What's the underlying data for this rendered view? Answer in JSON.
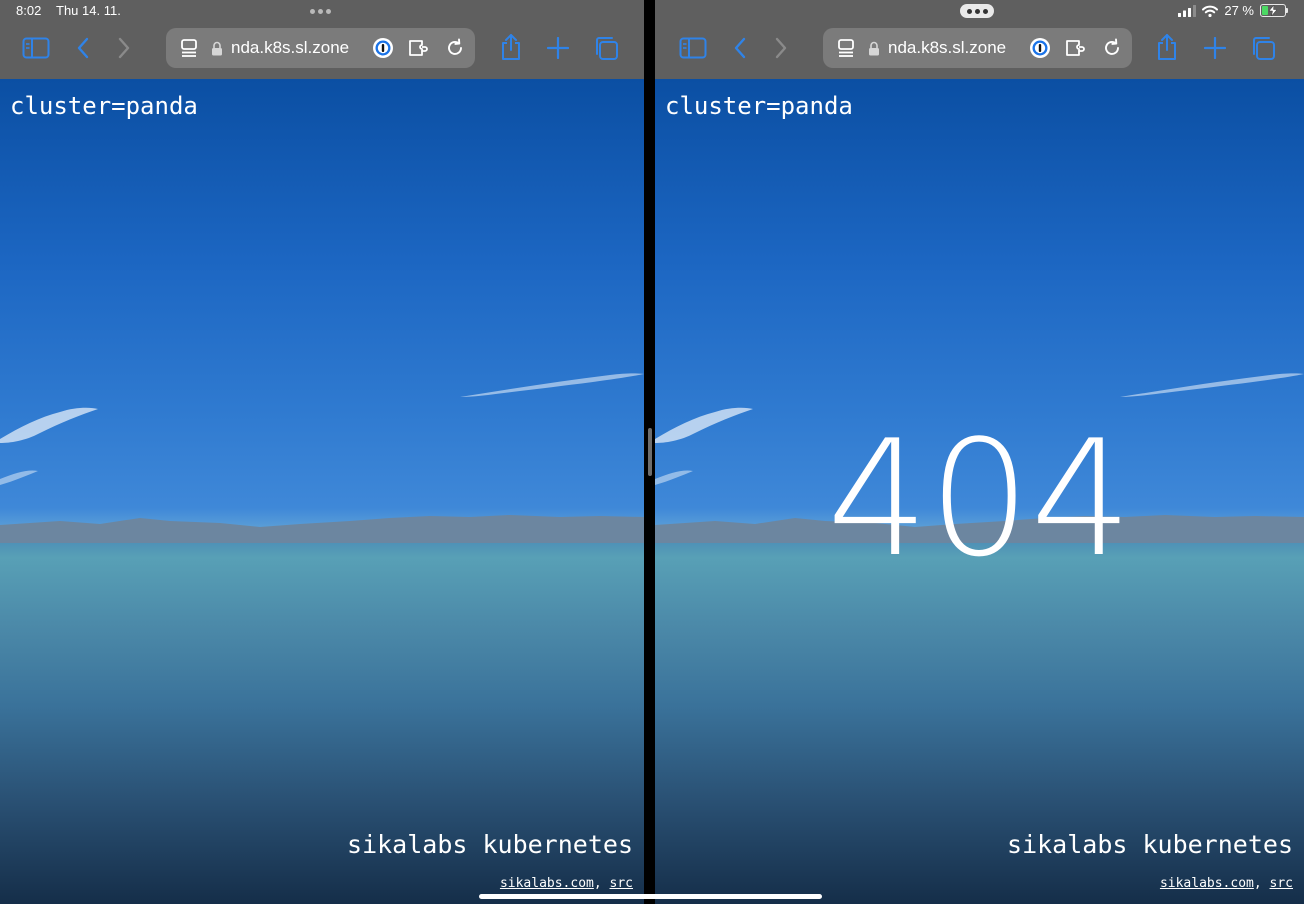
{
  "status_bar": {
    "time": "8:02",
    "date": "Thu 14. 11.",
    "battery_percent": "27 %",
    "battery_level": 0.27
  },
  "browser": {
    "url_display": "nda.k8s.sl.zone"
  },
  "page": {
    "cluster_label": "cluster=panda",
    "brand": "sikalabs kubernetes",
    "footer_link_1": "sikalabs.com",
    "footer_separator": ", ",
    "footer_link_2": "src",
    "error_code": "404"
  },
  "colors": {
    "accent": "#2f83e8",
    "chrome": "#5f5f5f",
    "battery_charging": "#4cd964"
  },
  "icons": [
    "sidebar-icon",
    "back-icon",
    "forward-icon",
    "page-menu-icon",
    "lock-icon",
    "password-manager-icon",
    "extensions-icon",
    "reload-icon",
    "share-icon",
    "new-tab-icon",
    "tabs-overview-icon",
    "signal-icon",
    "wifi-icon",
    "battery-icon"
  ]
}
